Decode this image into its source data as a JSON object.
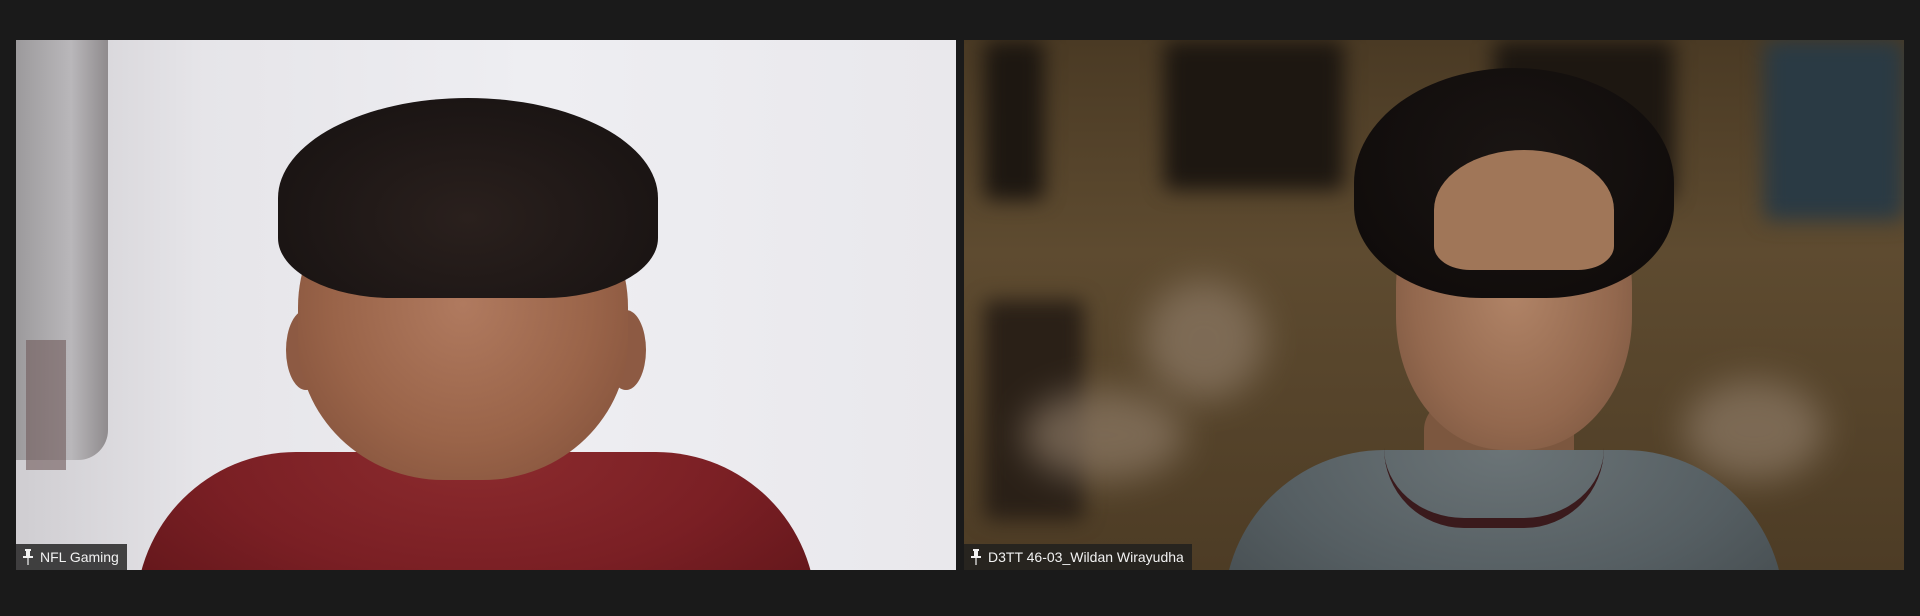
{
  "participants": [
    {
      "name": "NFL Gaming",
      "pinned": true,
      "pin_icon": "pin-icon"
    },
    {
      "name": "D3TT 46-03_Wildan Wirayudha",
      "pinned": true,
      "pin_icon": "pin-icon"
    }
  ],
  "colors": {
    "background": "#1a1a1a",
    "nametag_bg": "#1e1e1e",
    "nametag_text": "#f2f2f2"
  }
}
